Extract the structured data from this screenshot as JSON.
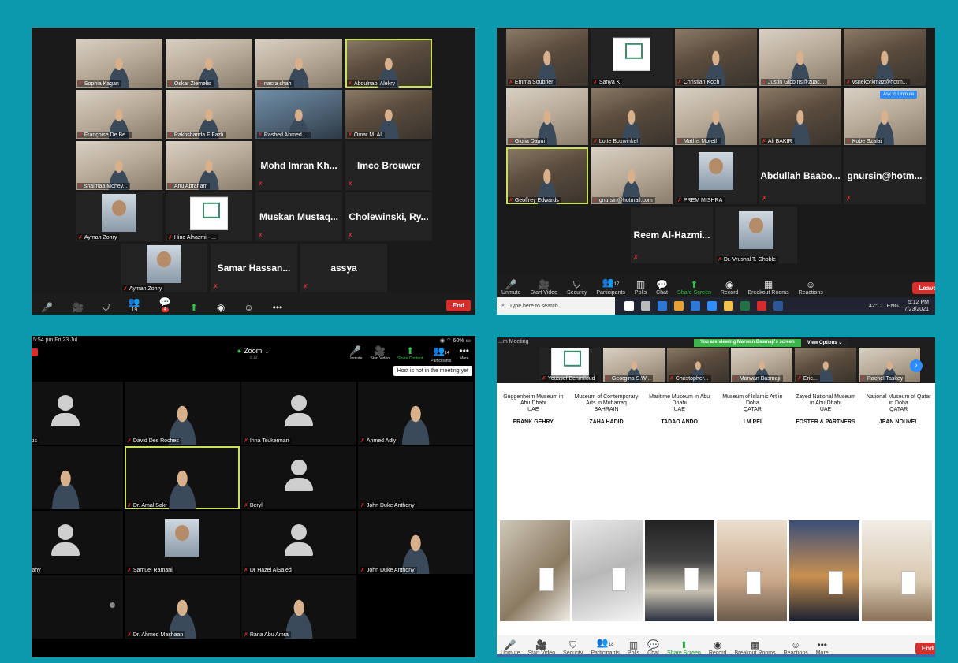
{
  "panel1": {
    "tiles": [
      {
        "name": "Sophia Kagan",
        "kind": "video"
      },
      {
        "name": "Oskar Ziemelis",
        "kind": "video"
      },
      {
        "name": "nasra shah",
        "kind": "video"
      },
      {
        "name": "Abdulnabi Alekry",
        "kind": "video"
      },
      {
        "name": "Françoise De Be...",
        "kind": "video"
      },
      {
        "name": "Rakhshanda F Fazli",
        "kind": "video"
      },
      {
        "name": "Rashed Ahmed ...",
        "kind": "video"
      },
      {
        "name": "Omar M. Ali",
        "kind": "video"
      },
      {
        "name": "shaimaa Mohey...",
        "kind": "video"
      },
      {
        "name": "Anu Abraham",
        "kind": "video"
      },
      {
        "name": "Mohd Imran Kh...",
        "kind": "name"
      },
      {
        "name": "Imco Brouwer",
        "kind": "name"
      },
      {
        "name": "Ayman Zohry",
        "kind": "photo"
      },
      {
        "name": "Hind Alhazmi - ...",
        "kind": "logo"
      },
      {
        "name": "Muskan Mustaq...",
        "kind": "name"
      },
      {
        "name": "Cholewinski, Ry...",
        "kind": "name"
      },
      {
        "name": "Ayman Zohry",
        "kind": "photo"
      },
      {
        "name": "Samar Hassan...",
        "kind": "name"
      },
      {
        "name": "assya",
        "kind": "name"
      }
    ],
    "participants_count": "19",
    "chat_badge": "4",
    "end_label": "End"
  },
  "panel2": {
    "tiles": [
      {
        "name": "Emma Soubrier",
        "kind": "video"
      },
      {
        "name": "Sanya K",
        "kind": "logo"
      },
      {
        "name": "Christian Koch",
        "kind": "video"
      },
      {
        "name": "Justin Gibbins@zuac...",
        "kind": "video"
      },
      {
        "name": "vsnekorkmaz@hotm...",
        "kind": "video"
      },
      {
        "name": "Giulia Dagui",
        "kind": "video"
      },
      {
        "name": "Lotte Boxwinkel",
        "kind": "video"
      },
      {
        "name": "Mathis Moreth",
        "kind": "video"
      },
      {
        "name": "Ali BAKIR",
        "kind": "video"
      },
      {
        "name": "Kobe Szalai",
        "kind": "video"
      },
      {
        "name": "Geoffrey Edwards",
        "kind": "video"
      },
      {
        "name": "gnursin@hotmail.com",
        "kind": "video"
      },
      {
        "name": "PREM MISHRA",
        "kind": "photo"
      },
      {
        "name": "Abdullah Baabo...",
        "kind": "name"
      },
      {
        "name": "gnursin@hotm...",
        "kind": "name"
      },
      {
        "name": "Reem Al-Hazmi...",
        "kind": "name"
      },
      {
        "name": "Dr. Vrushal T. Ghoble",
        "kind": "photo"
      }
    ],
    "ask_unmute": "Ask to Unmute",
    "toolbar": [
      "Unmute",
      "Start Video",
      "Security",
      "Participants",
      "Polls",
      "Chat",
      "Share Screen",
      "Record",
      "Breakout Rooms",
      "Reactions"
    ],
    "participants_count": "17",
    "leave_label": "Leave",
    "search_placeholder": "Type here to search",
    "temperature": "42°C",
    "language": "ENG",
    "time": "5:12 PM",
    "date": "7/23/2021"
  },
  "panel3": {
    "status_time": "5:54 pm  Fri 23 Jul",
    "battery": "60%",
    "title": "Zoom",
    "subtitle": "0:12",
    "controls": [
      "Unmute",
      "Start Video",
      "Share Content",
      "Participants",
      "More"
    ],
    "participants_count": "14",
    "tooltip": "Host is not in the meeting yet",
    "tiles": [
      {
        "name": "...anakis",
        "kind": "avatar"
      },
      {
        "name": "David Des Roches",
        "kind": "video"
      },
      {
        "name": "Irina Tsukerman",
        "kind": "avatar"
      },
      {
        "name": "Ahmed Adly",
        "kind": "video"
      },
      {
        "name": "",
        "kind": "video"
      },
      {
        "name": "Dr. Amal Sakr",
        "kind": "video"
      },
      {
        "name": "Beryl",
        "kind": "avatar"
      },
      {
        "name": "John Duke Anthony",
        "kind": "blank"
      },
      {
        "name": "...e Leahy",
        "kind": "avatar"
      },
      {
        "name": "Samuel Ramani",
        "kind": "photo"
      },
      {
        "name": "Dr Hazel AlSaied",
        "kind": "avatar"
      },
      {
        "name": "John Duke Anthony",
        "kind": "video"
      },
      {
        "name": "",
        "kind": "blank"
      },
      {
        "name": "Dr. Ahmed Mashaan",
        "kind": "video"
      },
      {
        "name": "Rana Abu Amra",
        "kind": "video"
      },
      {
        "name": "",
        "kind": "none"
      }
    ]
  },
  "panel4": {
    "meeting_title": "...m Meeting",
    "viewing_banner": "You are viewing Marwan Basmaji's screen",
    "view_options": "View Options",
    "strip": [
      {
        "name": "Youssef Benmiloud",
        "kind": "logo"
      },
      {
        "name": "Georgina S.W...",
        "kind": "video"
      },
      {
        "name": "Christopher...",
        "kind": "video"
      },
      {
        "name": "Marwan Basmaji",
        "kind": "video"
      },
      {
        "name": "Eric...",
        "kind": "video"
      },
      {
        "name": "Rachel Taskey",
        "kind": "video"
      }
    ],
    "slide_columns": [
      {
        "lines": [
          "Guggenheim Museum in",
          "Abu Dhabi",
          "UAE"
        ],
        "architect": "FRANK GEHRY"
      },
      {
        "lines": [
          "Museum of Contemporary",
          "Arts in Muharraq",
          "BAHRAIN"
        ],
        "architect": "ZAHA HADID"
      },
      {
        "lines": [
          "Maritime Museum in Abu",
          "Dhabi",
          "UAE"
        ],
        "architect": "TADAO ANDO"
      },
      {
        "lines": [
          "Museum of Islamic Art in",
          "Doha",
          "QATAR"
        ],
        "architect": "I.M.PEI"
      },
      {
        "lines": [
          "Zayed National Museum",
          "in Abu Dhabi",
          "UAE"
        ],
        "architect": "FOSTER & PARTNERS"
      },
      {
        "lines": [
          "National Museum of Qatar",
          "in Doha",
          "QATAR"
        ],
        "architect": "JEAN NOUVEL"
      }
    ],
    "toolbar": [
      "Unmute",
      "Start Video",
      "Security",
      "Participants",
      "Polls",
      "Chat",
      "Share Screen",
      "Record",
      "Breakout Rooms",
      "Reactions",
      "More"
    ],
    "participants_count": "18",
    "end_label": "End"
  }
}
